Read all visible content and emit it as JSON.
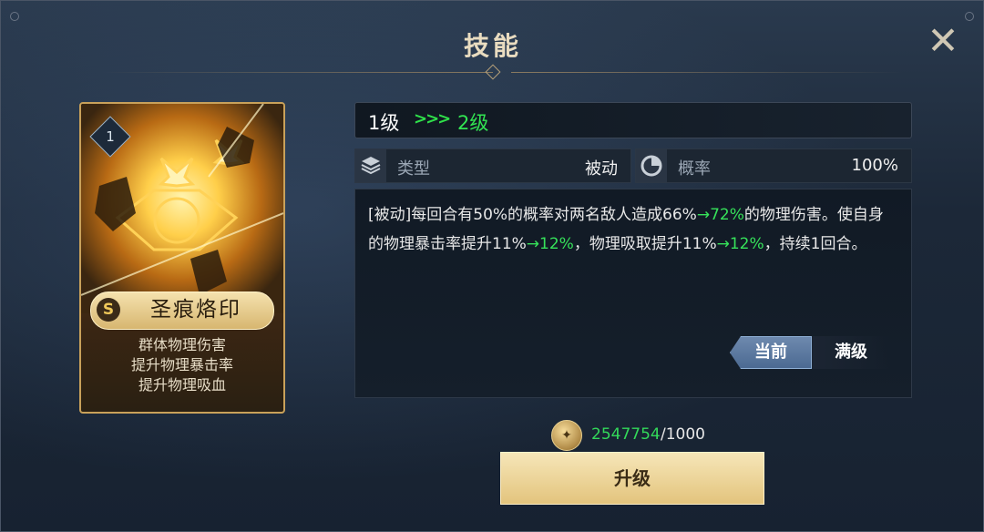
{
  "header": {
    "title": "技能",
    "close_icon": "close-icon"
  },
  "card": {
    "level_badge": "1",
    "rank": "S",
    "name": "圣痕烙印",
    "desc": [
      "群体物理伤害",
      "提升物理暴击率",
      "提升物理吸血"
    ]
  },
  "level": {
    "from": "1级",
    "arrows": ">>>",
    "to": "2级"
  },
  "stats": {
    "type": {
      "icon": "layers-icon",
      "label": "类型",
      "value": "被动"
    },
    "chance": {
      "icon": "pie-chart-icon",
      "label": "概率",
      "value": "100%"
    }
  },
  "description": {
    "p1": "[被动]每回合有50%的概率对两名敌人造成66%",
    "g1": "→72%",
    "p2": "的物理伤害。使自身的物理暴击率提升11%",
    "g2": "→12%",
    "p3": "，物理吸取提升11%",
    "g3": "→12%",
    "p4": "，持续1回合。"
  },
  "toggle": {
    "current": "当前",
    "max": "满级"
  },
  "cost": {
    "have": "2547754",
    "need": "/1000"
  },
  "buttons": {
    "upgrade": "升级"
  },
  "colors": {
    "accent_green": "#36e25a",
    "gold": "#e3c47d"
  }
}
